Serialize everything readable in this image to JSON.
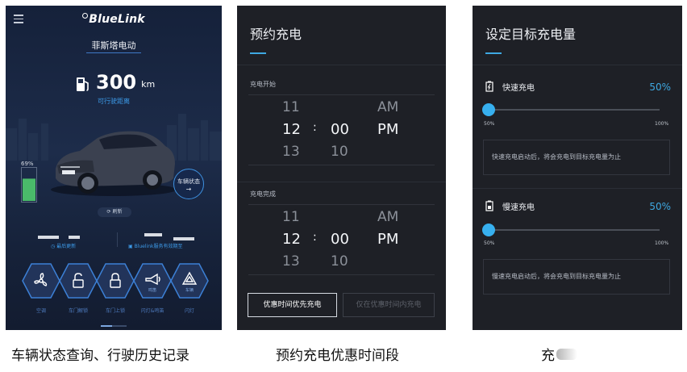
{
  "screen1": {
    "brand": "BlueLink",
    "vehicle_name": "菲斯塔电动",
    "range_value": "300",
    "range_unit": "km",
    "range_label": "可行驶距离",
    "battery_percent": "69%",
    "battery_level": 0.69,
    "vehicle_status_label": "车辆状态",
    "vehicle_status_arrow": "→",
    "refresh_label": "刷新",
    "last_update_label": "最后更新",
    "service_expiry_label": "Bluelink服务有效期至",
    "controls": [
      {
        "label": "空调",
        "icon": "fan-icon"
      },
      {
        "label": "车门解锁",
        "icon": "unlock-icon"
      },
      {
        "label": "车门上锁",
        "icon": "lock-icon"
      },
      {
        "label": "闪灯&鸣笛",
        "icon": "horn-icon",
        "sub": "鸣笛"
      },
      {
        "label": "闪灯",
        "icon": "hazard-icon",
        "sub": "车辆"
      }
    ]
  },
  "screen2": {
    "title": "预约充电",
    "start_label": "充电开始",
    "end_label": "充电完成",
    "start_picker": {
      "hours": [
        "11",
        "12",
        "13"
      ],
      "minutes": [
        "",
        "00",
        "10"
      ],
      "ampm": [
        "AM",
        "PM",
        ""
      ]
    },
    "end_picker": {
      "hours": [
        "11",
        "12",
        "13"
      ],
      "minutes": [
        "",
        "00",
        "10"
      ],
      "ampm": [
        "AM",
        "PM",
        ""
      ]
    },
    "colon": ":",
    "primary_button": "优惠时间优先充电",
    "secondary_button": "仅在优惠时间内充电"
  },
  "screen3": {
    "title": "设定目标充电量",
    "fast": {
      "title": "快速充电",
      "percent": "50%",
      "level": 0.5,
      "min": "50%",
      "max": "100%",
      "note": "快速充电启动后，将会充电到目标充电量为止"
    },
    "slow": {
      "title": "慢速充电",
      "percent": "50%",
      "level": 0.5,
      "min": "50%",
      "max": "100%",
      "note": "慢速充电启动后，将会充电到目标充电量为止"
    }
  },
  "captions": {
    "left": "车辆状态查询、行驶历史记录",
    "middle": "预约充电优惠时间段",
    "right": "充"
  },
  "colors": {
    "accent": "#3ea8e2",
    "panel_bg": "#1e2026",
    "app_bg": "#1a2640"
  }
}
